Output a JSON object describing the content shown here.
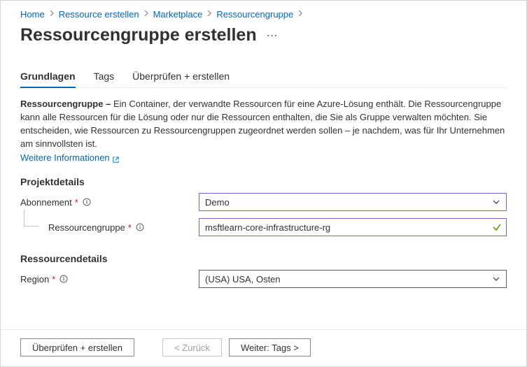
{
  "breadcrumb": {
    "items": [
      {
        "label": "Home"
      },
      {
        "label": "Ressource erstellen"
      },
      {
        "label": "Marketplace"
      },
      {
        "label": "Ressourcengruppe"
      }
    ]
  },
  "title": "Ressourcengruppe erstellen",
  "tabs": [
    {
      "label": "Grundlagen",
      "active": true
    },
    {
      "label": "Tags",
      "active": false
    },
    {
      "label": "Überprüfen + erstellen",
      "active": false
    }
  ],
  "description": {
    "lead": "Ressourcengruppe – ",
    "body": "Ein Container, der verwandte Ressourcen für eine Azure-Lösung enthält. Die Ressourcengruppe kann alle Ressourcen für die Lösung oder nur die Ressourcen enthalten, die Sie als Gruppe verwalten möchten. Sie entscheiden, wie Ressourcen zu Ressourcengruppen zugeordnet werden sollen – je nachdem, was für Ihr Unternehmen am sinnvollsten ist.",
    "link": "Weitere Informationen"
  },
  "sections": {
    "project": {
      "title": "Projektdetails",
      "subscription": {
        "label": "Abonnement",
        "value": "Demo"
      },
      "resourceGroup": {
        "label": "Ressourcengruppe",
        "value": "msftlearn-core-infrastructure-rg"
      }
    },
    "resource": {
      "title": "Ressourcendetails",
      "region": {
        "label": "Region",
        "value": "(USA) USA, Osten"
      }
    }
  },
  "footer": {
    "review": "Überprüfen + erstellen",
    "back": "< Zurück",
    "next": "Weiter: Tags >"
  }
}
